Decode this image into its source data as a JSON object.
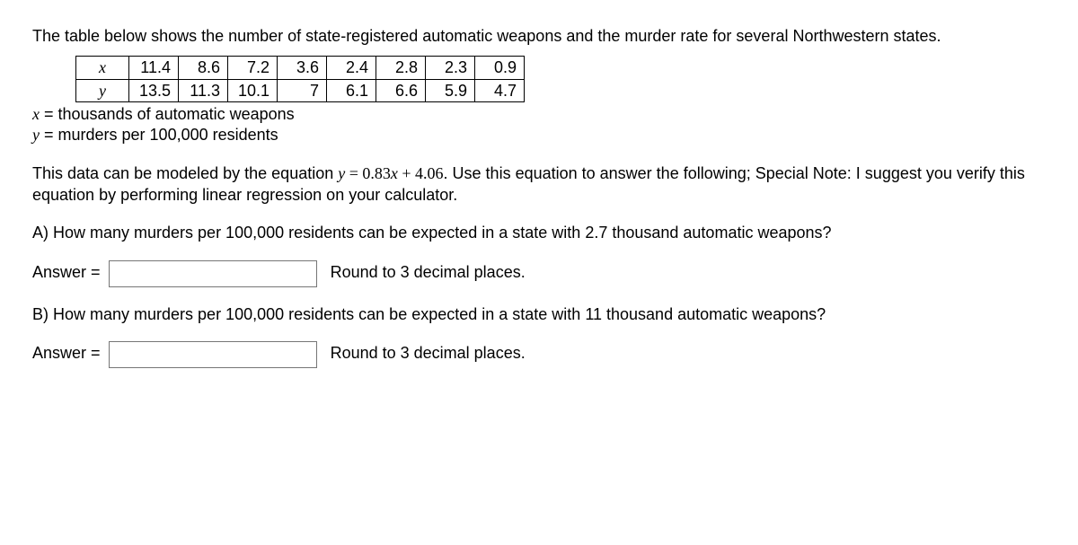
{
  "intro": "The table below shows the number of state-registered automatic weapons and the murder rate for several Northwestern states.",
  "table": {
    "x_label": "x",
    "y_label": "y",
    "x": [
      "11.4",
      "8.6",
      "7.2",
      "3.6",
      "2.4",
      "2.8",
      "2.3",
      "0.9"
    ],
    "y": [
      "13.5",
      "11.3",
      "10.1",
      "7",
      "6.1",
      "6.6",
      "5.9",
      "4.7"
    ]
  },
  "defs": {
    "x_var": "x",
    "x_text": " = thousands of automatic weapons",
    "y_var": "y",
    "y_text": " = murders per 100,000 residents"
  },
  "model": {
    "prefix": "This data can be modeled by the equation ",
    "eq_lhs": "y",
    "eq_mid": " = 0.83",
    "eq_var2": "x",
    "eq_rhs": " + 4.06",
    "suffix": ".  Use this equation to answer the following; Special Note: I suggest you verify this equation by performing linear regression on your calculator."
  },
  "partA": {
    "prompt": "A) How many murders per 100,000 residents can be expected in a state with 2.7 thousand automatic weapons?",
    "answer_label": "Answer =",
    "hint": "Round to 3 decimal places."
  },
  "partB": {
    "prompt": "B) How many murders per 100,000 residents can be expected in a state with 11 thousand automatic weapons?",
    "answer_label": "Answer =",
    "hint": "Round to 3 decimal places."
  },
  "chart_data": {
    "type": "table",
    "columns": [
      "x (thousands of automatic weapons)",
      "y (murders per 100,000 residents)"
    ],
    "rows": [
      [
        11.4,
        13.5
      ],
      [
        8.6,
        11.3
      ],
      [
        7.2,
        10.1
      ],
      [
        3.6,
        7
      ],
      [
        2.4,
        6.1
      ],
      [
        2.8,
        6.6
      ],
      [
        2.3,
        5.9
      ],
      [
        0.9,
        4.7
      ]
    ],
    "regression": {
      "slope": 0.83,
      "intercept": 4.06
    }
  }
}
